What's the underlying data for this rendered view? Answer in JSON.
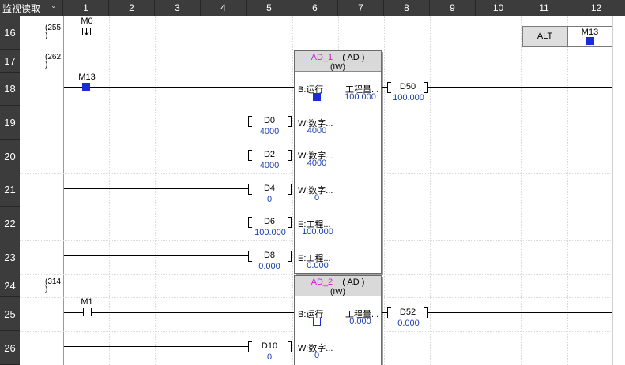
{
  "header": {
    "corner_label": "监视读取",
    "corner_icon": "chevron-down-icon",
    "columns": [
      "1",
      "2",
      "3",
      "4",
      "5",
      "6",
      "7",
      "8",
      "9",
      "10",
      "11",
      "12"
    ]
  },
  "rows": [
    "16",
    "17",
    "18",
    "19",
    "20",
    "21",
    "22",
    "23",
    "24",
    "25",
    "26"
  ],
  "steps": {
    "s255": "(255\n)",
    "s262": "(262\n)",
    "s314": "(314\n)"
  },
  "rung16": {
    "contact_device": "M0",
    "contact_type": "pulse-falling",
    "instruction": "ALT",
    "coil_device": "M13",
    "coil_state": "on"
  },
  "ad1": {
    "name": "AD_1",
    "type_paren": "( AD )",
    "subtype": "(IW)",
    "enable_contact": "M13",
    "enable_state": "on",
    "pins": {
      "run": "B:运行",
      "eng_out": "工程量...",
      "w1": "W:数字...",
      "w2": "W:数字...",
      "w3": "W:数字...",
      "e1": "E:工程...",
      "e2": "E:工程..."
    },
    "pin_values": {
      "eng_out": "100.000",
      "w1": "4000",
      "w2": "4000",
      "w3": "0",
      "e1": "100.000",
      "e2": "0.000"
    },
    "out_device": "D50",
    "out_value": "100.000",
    "inputs": [
      {
        "device": "D0",
        "value": "4000"
      },
      {
        "device": "D2",
        "value": "4000"
      },
      {
        "device": "D4",
        "value": "0"
      },
      {
        "device": "D6",
        "value": "100.000"
      },
      {
        "device": "D8",
        "value": "0.000"
      }
    ]
  },
  "ad2": {
    "name": "AD_2",
    "type_paren": "( AD )",
    "subtype": "(IW)",
    "enable_contact": "M1",
    "enable_state": "off",
    "pins": {
      "run": "B:运行",
      "eng_out": "工程量...",
      "w1": "W:数字..."
    },
    "pin_values": {
      "eng_out": "0.000",
      "w1": "0"
    },
    "out_device": "D52",
    "out_value": "0.000",
    "inputs": [
      {
        "device": "D10",
        "value": "0"
      }
    ]
  },
  "colors": {
    "header_bg": "#3c3c3c",
    "header_text": "#ffffff",
    "value_text": "#1b3fae",
    "fb_name": "#d619d6",
    "state_on": "#1d2bd6"
  }
}
